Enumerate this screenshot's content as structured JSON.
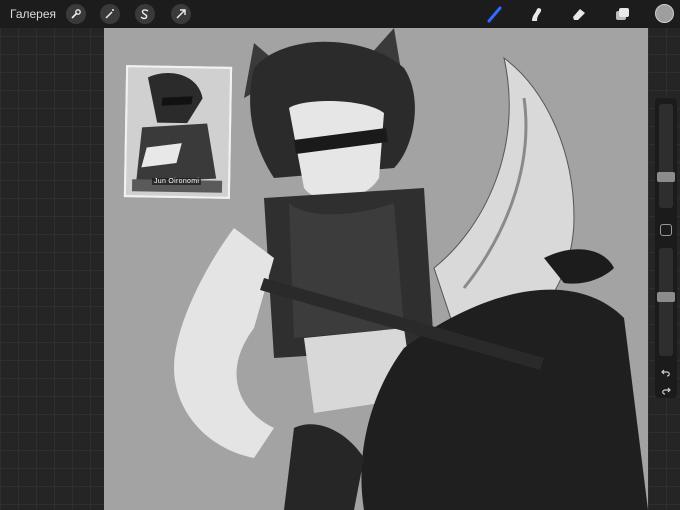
{
  "topbar": {
    "gallery_label": "Галерея",
    "left_tools": [
      "wrench-icon",
      "magic-wand-icon",
      "selection-s-icon",
      "transform-arrow-icon"
    ],
    "right_tools": [
      "brush-icon",
      "smudge-icon",
      "eraser-icon",
      "layers-icon"
    ],
    "active_tool": "brush-icon",
    "accent_color": "#2f6bff",
    "current_color": "#9e9e9e"
  },
  "reference_card": {
    "label": "Jun Oironomi"
  },
  "sidebar": {
    "brush_size_level": 0.28,
    "opacity_level": 0.55
  }
}
